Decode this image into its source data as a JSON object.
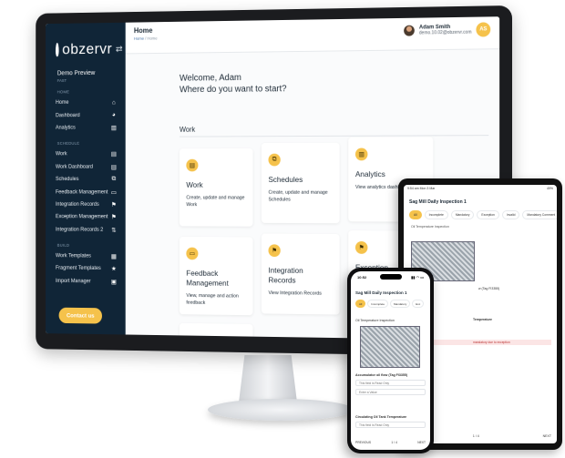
{
  "brand": {
    "name": "obzervr",
    "accent": "#f5c24b",
    "sidebar_bg": "#102537"
  },
  "sidebar": {
    "org_name": "Demo Preview",
    "org_sub": "FAST",
    "sections": {
      "home": "HOME",
      "schedule": "SCHEDULE",
      "build": "BUILD"
    },
    "home_items": [
      {
        "label": "Home",
        "icon": "home-icon"
      },
      {
        "label": "Dashboard",
        "icon": "dashboard-icon"
      },
      {
        "label": "Analytics",
        "icon": "bar-chart-icon"
      }
    ],
    "schedule_items": [
      {
        "label": "Work",
        "icon": "clipboard-icon"
      },
      {
        "label": "Work Dashboard",
        "icon": "clipboard-icon"
      },
      {
        "label": "Schedules",
        "icon": "schedule-icon"
      },
      {
        "label": "Feedback Management",
        "icon": "chat-icon"
      },
      {
        "label": "Integration Records",
        "icon": "flag-icon"
      },
      {
        "label": "Exception Management",
        "icon": "flag-icon"
      },
      {
        "label": "Integration Records 2",
        "icon": "sync-icon"
      }
    ],
    "build_items": [
      {
        "label": "Work Templates",
        "icon": "template-icon"
      },
      {
        "label": "Fragment Templates",
        "icon": "star-icon"
      },
      {
        "label": "Import Manager",
        "icon": "import-icon"
      }
    ],
    "contact_label": "Contact us"
  },
  "header": {
    "title": "Home",
    "breadcrumb": [
      "Home",
      "Home"
    ],
    "user_name": "Adam Smith",
    "user_email": "demo.10.02@obzervr.com",
    "user_initials": "AS"
  },
  "main": {
    "welcome_line1": "Welcome, Adam",
    "welcome_line2": "Where do you want to start?",
    "section_title": "Work",
    "cards": [
      {
        "title": "Work",
        "desc": "Create, update and manage Work",
        "icon": "clipboard-icon"
      },
      {
        "title": "Schedules",
        "desc": "Create, update and manage Schedules",
        "icon": "schedule-icon"
      },
      {
        "title": "Analytics",
        "desc": "View analytics dashboards",
        "icon": "bar-chart-icon"
      },
      {
        "title": "Feedback Management",
        "desc": "View, manage and action feedback",
        "icon": "chat-icon"
      },
      {
        "title": "Integration Records",
        "desc": "View Integration Records",
        "icon": "flag-icon"
      },
      {
        "title": "Exception",
        "desc": "",
        "icon": "flag-icon"
      }
    ]
  },
  "tablet": {
    "status_left": "9:54 am  Mon 3 Mar",
    "status_right": "49%",
    "title": "Sag Mill Daily Inspection 1",
    "tabs": [
      "All",
      "Incomplete",
      "Mandatory",
      "Exception",
      "Invalid",
      "Mandatory Comment"
    ],
    "active_tab": "All",
    "section": "Oil Temperature Inspection",
    "field1": "w (Tag FI3355)",
    "field2": "Temperature",
    "error": "mandatory due to exception",
    "pagination": "1 / 4",
    "next": "NEXT"
  },
  "phone": {
    "time": "10:52",
    "title": "Sag Mill Daily Inspection 1",
    "tabs": [
      "All",
      "Incomplete",
      "Mandatory",
      "Exc"
    ],
    "active_tab": "All",
    "section": "Oil Temperature Inspection",
    "field1": "Accumulator oil flow (Tag FI3355)",
    "readonly1": "This field is Read Only",
    "placeholder": "Enter a Value",
    "field2": "Circulating Oil Tank Temperature",
    "readonly2": "This field is Read Only",
    "prev": "PREVIOUS",
    "pagination": "1 / 4",
    "next": "NEXT"
  }
}
